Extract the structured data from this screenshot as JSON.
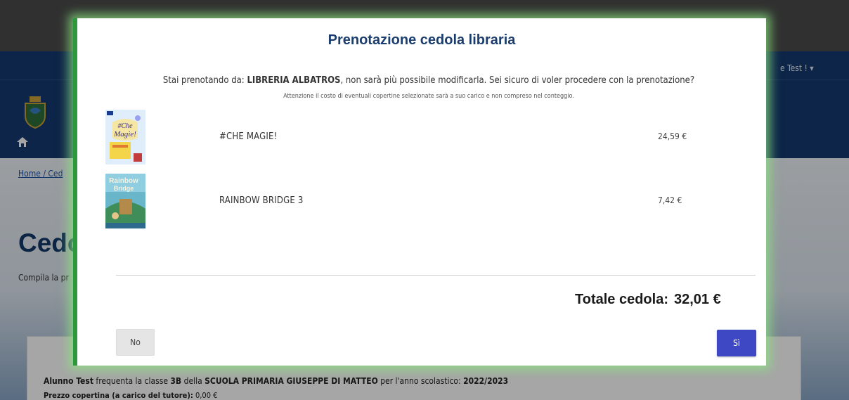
{
  "background": {
    "user_menu": "e Test ! ▾",
    "breadcrumb": "Home / Ced",
    "page_title": "Cedol",
    "page_subtitle": "Compila la pr",
    "info": {
      "student": "Alunno Test",
      "t1": " frequenta la classe ",
      "class": "3B",
      "t2": " della ",
      "school": "SCUOLA PRIMARIA GIUSEPPE DI MATTEO",
      "t3": " per l'anno scolastico: ",
      "year": "2022/2023"
    },
    "price_line": {
      "label": "Prezzo copertina (a carico del tutore):",
      "value": " 0,00 €"
    }
  },
  "modal": {
    "title": "Prenotazione cedola libraria",
    "confirm_prefix": "Stai prenotando da: ",
    "bookstore": "LIBRERIA ALBATROS",
    "confirm_suffix": ", non sarà più possibile modificarla. Sei sicuro di voler procedere con la prenotazione?",
    "warning": "Attenzione il costo di eventuali copertine selezionate sarà a suo carico e non compreso nel conteggio.",
    "books": [
      {
        "title": "#CHE MAGIE!",
        "price": "24,59 €",
        "cover_text": "#Che Magie!"
      },
      {
        "title": "RAINBOW BRIDGE 3",
        "price": "7,42 €",
        "cover_text": "Rainbow Bridge"
      }
    ],
    "total_label": "Totale cedola:",
    "total_value": "32,01 €",
    "no_label": "No",
    "yes_label": "Sì"
  },
  "colors": {
    "header_blue": "#14396f",
    "modal_border_green": "#2c9a3c",
    "yes_button": "#3e48c4",
    "title_blue": "#1c3e6e"
  },
  "icons": {
    "home": "home-icon",
    "user_menu_caret": "chevron-down-icon",
    "crest": "municipal-crest-logo"
  }
}
